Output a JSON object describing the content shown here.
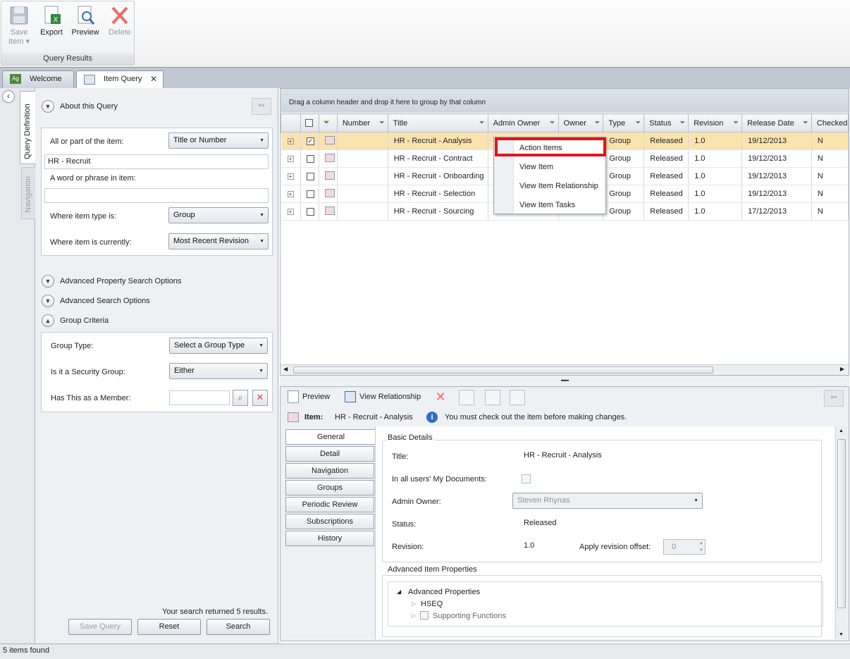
{
  "ribbon": {
    "buttons": [
      {
        "label": "Save Item",
        "arrow": "▾",
        "icon": "save-icon",
        "enabled": false
      },
      {
        "label": "Export",
        "icon": "excel-export-icon",
        "enabled": true
      },
      {
        "label": "Preview",
        "icon": "preview-icon",
        "enabled": true
      },
      {
        "label": "Delete",
        "icon": "delete-icon",
        "enabled": false
      }
    ],
    "group_label": "Query Results"
  },
  "tabs": [
    {
      "label": "Welcome",
      "icon": "app-logo-icon"
    },
    {
      "label": "Item Query",
      "icon": "query-icon",
      "close": "✕"
    }
  ],
  "sidebar": {
    "tab_query": "Query Definition",
    "tab_navigation": "Navigation"
  },
  "query": {
    "about_header": "About this Query",
    "item_label": "All or part of the item:",
    "item_mode": "Title or Number",
    "item_value": "HR - Recruit",
    "phrase_label": "A word or phrase in item:",
    "phrase_value": "",
    "type_label": "Where item type is:",
    "type_value": "Group",
    "current_label": "Where item is currently:",
    "current_value": "Most Recent Revision",
    "adv_property": "Advanced Property Search Options",
    "adv_search": "Advanced Search Options",
    "group_criteria": "Group Criteria",
    "group_type_label": "Group Type:",
    "group_type_value": "Select a Group Type",
    "security_label": "Is it a Security Group:",
    "security_value": "Either",
    "member_label": "Has This as a Member:",
    "member_value": "",
    "result_text": "Your search returned 5 results.",
    "save_query": "Save Query",
    "reset": "Reset",
    "search": "Search"
  },
  "grid": {
    "group_hint": "Drag a column header and drop it here to group by that column",
    "columns": [
      "Number",
      "Title",
      "Admin Owner",
      "Owner",
      "Type",
      "Status",
      "Revision",
      "Release Date",
      "Checked"
    ],
    "rows": [
      {
        "number": "",
        "title": "HR - Recruit - Analysis",
        "type": "Group",
        "status": "Released",
        "revision": "1.0",
        "release_date": "19/12/2013",
        "checked": "N",
        "selected": true
      },
      {
        "number": "",
        "title": "HR - Recruit - Contract",
        "type": "Group",
        "status": "Released",
        "revision": "1.0",
        "release_date": "19/12/2013",
        "checked": "N",
        "selected": false
      },
      {
        "number": "",
        "title": "HR - Recruit - Onboarding",
        "type": "Group",
        "status": "Released",
        "revision": "1.0",
        "release_date": "19/12/2013",
        "checked": "N",
        "selected": false
      },
      {
        "number": "",
        "title": "HR - Recruit - Selection",
        "type": "Group",
        "status": "Released",
        "revision": "1.0",
        "release_date": "19/12/2013",
        "checked": "N",
        "selected": false
      },
      {
        "number": "",
        "title": "HR - Recruit - Sourcing",
        "type": "Group",
        "status": "Released",
        "revision": "1.0",
        "release_date": "17/12/2013",
        "checked": "N",
        "selected": false
      }
    ]
  },
  "context_menu": {
    "items": [
      "Action Items",
      "View Item",
      "View Item Relationship",
      "View Item Tasks"
    ],
    "highlight_color": "#e3141b"
  },
  "detail": {
    "preview": "Preview",
    "view_relationship": "View Relationship",
    "item_prefix": "Item:",
    "item_name": "HR - Recruit - Analysis",
    "notice": "You must check out the item before making changes.",
    "tabs": [
      "General",
      "Detail",
      "Navigation",
      "Groups",
      "Periodic Review",
      "Subscriptions",
      "History"
    ],
    "basic_legend": "Basic Details",
    "title_label": "Title:",
    "title_value": "HR - Recruit - Analysis",
    "mydocs_label": "In all users' My Documents:",
    "admin_label": "Admin Owner:",
    "admin_value": "Steven Rhynas",
    "status_label": "Status:",
    "status_value": "Released",
    "revision_label": "Revision:",
    "revision_value": "1.0",
    "offset_label": "Apply revision offset:",
    "offset_value": "0",
    "adv_legend": "Advanced Item Properties",
    "tree_root": "Advanced Properties",
    "tree_children": [
      "HSEQ",
      "Supporting Functions"
    ]
  },
  "status_bar": "5 items found",
  "colors": {
    "accent_green": "#6cb86c",
    "selected_row": "#fbe3b0",
    "tab_bar": "#bfc7d3"
  }
}
